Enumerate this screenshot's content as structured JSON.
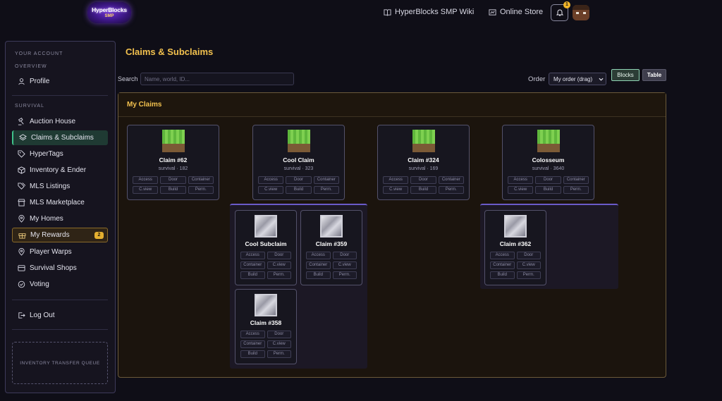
{
  "header": {
    "logo_line1": "HyperBlocks",
    "logo_line2": "SMP",
    "wiki_label": "HyperBlocks SMP Wiki",
    "store_label": "Online Store",
    "notification_count": "1"
  },
  "sidebar": {
    "your_account_label": "YOUR ACCOUNT",
    "overview_label": "OVERVIEW",
    "profile_label": "Profile",
    "survival_label": "SURVIVAL",
    "items": [
      {
        "label": "Auction House",
        "icon": "auction-icon"
      },
      {
        "label": "Claims & Subclaims",
        "icon": "layers-icon"
      },
      {
        "label": "HyperTags",
        "icon": "tag-icon"
      },
      {
        "label": "Inventory & Ender",
        "icon": "box-icon"
      },
      {
        "label": "MLS Listings",
        "icon": "tags-icon"
      },
      {
        "label": "MLS Marketplace",
        "icon": "store-icon"
      },
      {
        "label": "My Homes",
        "icon": "pin-icon"
      },
      {
        "label": "My Rewards",
        "icon": "gift-icon",
        "badge": "2"
      },
      {
        "label": "Player Warps",
        "icon": "pin-icon"
      },
      {
        "label": "Survival Shops",
        "icon": "cart-icon"
      },
      {
        "label": "Voting",
        "icon": "check-circle-icon"
      }
    ],
    "logout_label": "Log Out",
    "queue_label": "INVENTORY TRANSFER QUEUE"
  },
  "main": {
    "title": "Claims & Subclaims",
    "search_label": "Search",
    "search_placeholder": "Name, world, ID...",
    "order_label": "Order",
    "order_value": "My order (drag)",
    "blocks_label": "Blocks",
    "table_label": "Table",
    "panel_title": "My Claims",
    "claim_buttons": [
      "Access",
      "Door",
      "Container",
      "C.view",
      "Build",
      "Perm."
    ],
    "claims": [
      {
        "name": "Claim #62",
        "meta": "survival · 182"
      },
      {
        "name": "Cool Claim",
        "meta": "survival · 323"
      },
      {
        "name": "Claim #324",
        "meta": "survival · 169"
      },
      {
        "name": "Colosseum",
        "meta": "survival · 3640"
      }
    ],
    "subclaims": [
      {
        "name": "Cool Subclaim"
      },
      {
        "name": "Claim #359"
      },
      {
        "name": "Claim #358"
      },
      {
        "name": "Claim #362"
      }
    ]
  },
  "colors": {
    "accent_gold": "#f2c14e",
    "active_green": "#3fc38a",
    "background": "#0f0e17"
  }
}
